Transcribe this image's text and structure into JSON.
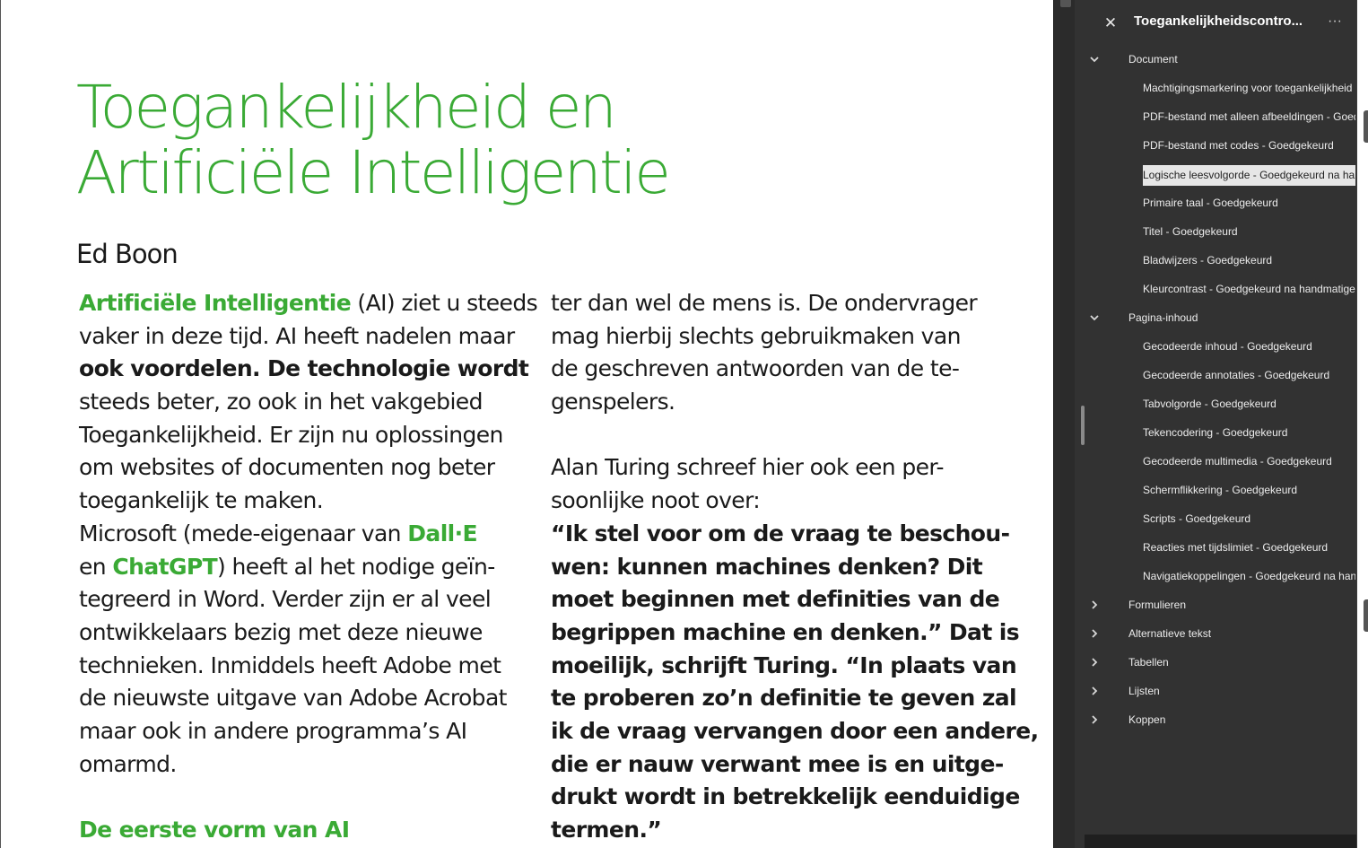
{
  "document": {
    "title_lines": [
      "Toegankelijkheid en",
      "Artificiële Intelligentie"
    ],
    "author": "Ed Boon",
    "column1": [
      [
        {
          "t": "Artificiële Intelligentie",
          "s": "hl"
        },
        {
          "t": " (AI) ziet u steeds"
        }
      ],
      [
        {
          "t": "vaker in deze tijd. AI heeft nadelen maar"
        }
      ],
      [
        {
          "t": "ook voordelen. De technologie wordt",
          "s": "b"
        }
      ],
      [
        {
          "t": "steeds beter, zo ook in het vakgebied"
        }
      ],
      [
        {
          "t": "Toegankelijkheid. Er zijn nu oplossingen"
        }
      ],
      [
        {
          "t": "om websites of documenten nog beter"
        }
      ],
      [
        {
          "t": "toegankelijk te maken."
        }
      ],
      [
        {
          "t": "Microsoft (mede-eigenaar van "
        },
        {
          "t": "Dall·E",
          "s": "hl"
        }
      ],
      [
        {
          "t": "en "
        },
        {
          "t": "ChatGPT",
          "s": "hl"
        },
        {
          "t": ") heeft al het nodige geïn-"
        }
      ],
      [
        {
          "t": "tegreerd in Word. Verder zijn er al veel"
        }
      ],
      [
        {
          "t": "ontwikkelaars bezig met deze nieuwe"
        }
      ],
      [
        {
          "t": "technieken. Inmiddels heeft Adobe met"
        }
      ],
      [
        {
          "t": "de nieuwste uitgave van Adobe Acrobat"
        }
      ],
      [
        {
          "t": "maar ook in andere programma’s AI"
        }
      ],
      [
        {
          "t": "omarmd."
        }
      ],
      [],
      [
        {
          "t": "De eerste vorm van AI",
          "s": "hl"
        }
      ]
    ],
    "column2": [
      [
        {
          "t": "ter dan wel de mens is. De ondervrager"
        }
      ],
      [
        {
          "t": "mag hierbij slechts gebruikmaken van"
        }
      ],
      [
        {
          "t": "de geschreven antwoorden van de te-"
        }
      ],
      [
        {
          "t": "genspelers."
        }
      ],
      [],
      [
        {
          "t": "Alan Turing schreef hier ook een per-"
        }
      ],
      [
        {
          "t": "soonlijke noot over:"
        }
      ],
      [
        {
          "t": "“Ik stel voor om de vraag te beschou-",
          "s": "b"
        }
      ],
      [
        {
          "t": "wen: kunnen machines denken? Dit",
          "s": "b"
        }
      ],
      [
        {
          "t": "moet beginnen met definities van de",
          "s": "b"
        }
      ],
      [
        {
          "t": "begrippen machine en denken.” Dat is",
          "s": "b"
        }
      ],
      [
        {
          "t": "moeilijk, schrijft Turing. “In plaats van",
          "s": "b"
        }
      ],
      [
        {
          "t": "te proberen zo’n definitie te geven zal",
          "s": "b"
        }
      ],
      [
        {
          "t": "ik de vraag vervangen door een andere,",
          "s": "b"
        }
      ],
      [
        {
          "t": "die er nauw verwant mee is en uitge-",
          "s": "b"
        }
      ],
      [
        {
          "t": "drukt wordt in betrekkelijk eenduidige",
          "s": "b"
        }
      ],
      [
        {
          "t": "termen.”",
          "s": "b"
        }
      ]
    ]
  },
  "panel": {
    "close_label": "✕",
    "title": "Toegankelijkheidscontro...",
    "more_label": "···",
    "tree": [
      {
        "label": "Document",
        "expanded": true,
        "items": [
          {
            "label": "Machtigingsmarkering voor toegankelijkheid"
          },
          {
            "label": "PDF-bestand met alleen afbeeldingen - Goedgekeurd"
          },
          {
            "label": "PDF-bestand met codes - Goedgekeurd"
          },
          {
            "label": "Logische leesvolgorde - Goedgekeurd na handmatige controle",
            "selected": true
          },
          {
            "label": "Primaire taal - Goedgekeurd"
          },
          {
            "label": "Titel - Goedgekeurd"
          },
          {
            "label": "Bladwijzers - Goedgekeurd"
          },
          {
            "label": "Kleurcontrast - Goedgekeurd na handmatige controle"
          }
        ]
      },
      {
        "label": "Pagina-inhoud",
        "expanded": true,
        "items": [
          {
            "label": "Gecodeerde inhoud - Goedgekeurd"
          },
          {
            "label": "Gecodeerde annotaties - Goedgekeurd"
          },
          {
            "label": "Tabvolgorde - Goedgekeurd"
          },
          {
            "label": "Tekencodering - Goedgekeurd"
          },
          {
            "label": "Gecodeerde multimedia - Goedgekeurd"
          },
          {
            "label": "Schermflikkering - Goedgekeurd"
          },
          {
            "label": "Scripts - Goedgekeurd"
          },
          {
            "label": "Reacties met tijdslimiet - Goedgekeurd"
          },
          {
            "label": "Navigatiekoppelingen - Goedgekeurd na handmatige controle"
          }
        ]
      },
      {
        "label": "Formulieren",
        "expanded": false,
        "items": []
      },
      {
        "label": "Alternatieve tekst",
        "expanded": false,
        "items": []
      },
      {
        "label": "Tabellen",
        "expanded": false,
        "items": []
      },
      {
        "label": "Lijsten",
        "expanded": false,
        "items": []
      },
      {
        "label": "Koppen",
        "expanded": false,
        "items": []
      }
    ]
  }
}
